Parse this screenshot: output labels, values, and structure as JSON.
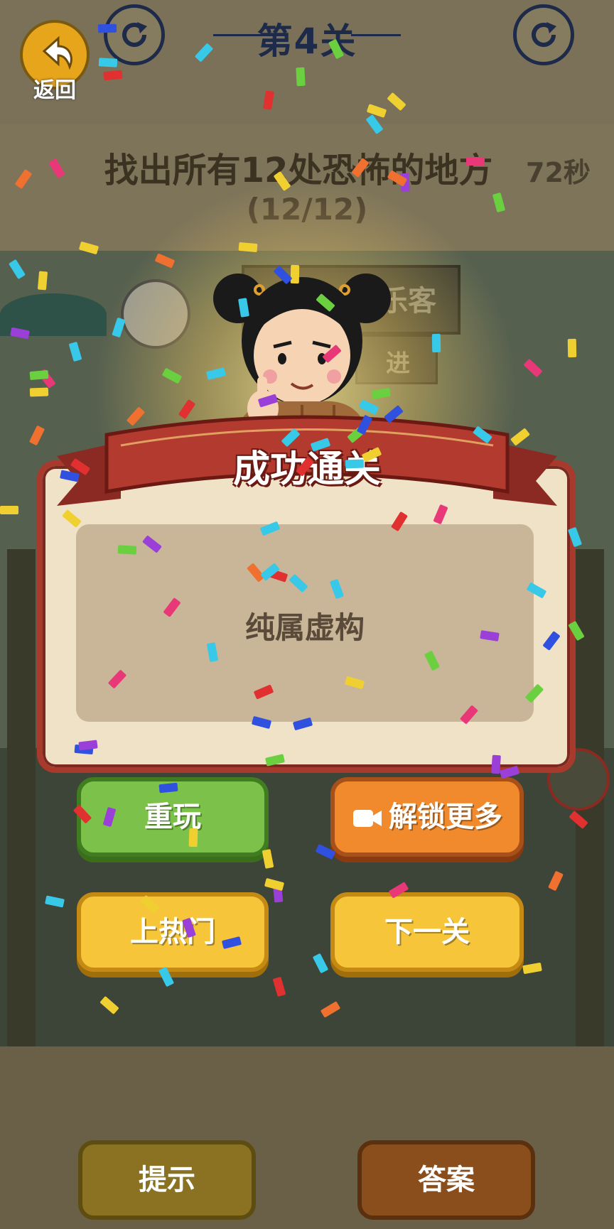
{
  "header": {
    "level_title": "第4关",
    "back_label": "返回"
  },
  "task": {
    "instruction": "找出所有12处恐怖的地方",
    "timer": "72秒",
    "progress": "(12/12)"
  },
  "result_dialog": {
    "banner": "成功通关",
    "message": "纯属虚构"
  },
  "actions": {
    "replay": "重玩",
    "unlock_more": "解锁更多",
    "go_trending": "上热门",
    "next_level": "下一关"
  },
  "bottom": {
    "hint": "提示",
    "answer": "答案"
  },
  "scene_sign": {
    "text": "乐客",
    "text2": "进"
  },
  "icons": {
    "back": "back-arrow-icon",
    "refresh": "refresh-icon",
    "video": "video-camera-icon"
  },
  "colors": {
    "banner_red": "#a8392d",
    "replay_green": "#7cc24a",
    "unlock_orange": "#f08a2c",
    "gold": "#f6c53a"
  }
}
